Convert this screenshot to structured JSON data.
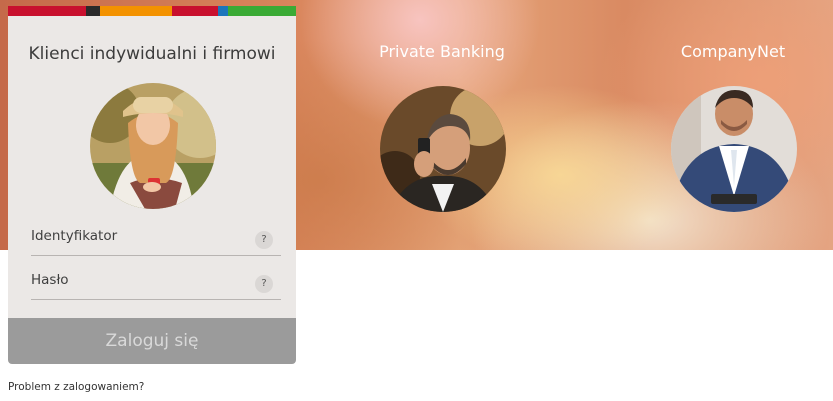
{
  "brand_colors": [
    "#c8102e",
    "#2a2a2a",
    "#f39200",
    "#c8102e",
    "#1b75bb",
    "#3aaa35"
  ],
  "login_panel": {
    "title": "Klienci indywidualni i firmowi",
    "fields": [
      {
        "label": "Identyfikator",
        "help": "?"
      },
      {
        "label": "Hasło",
        "help": "?"
      }
    ],
    "login_button": "Zaloguj się"
  },
  "problem_link": "Problem z zalogowaniem?",
  "sections": [
    {
      "title": "Private Banking"
    },
    {
      "title": "CompanyNet"
    }
  ],
  "icons": [
    "woman-avatar",
    "man-phone-avatar",
    "businessman-avatar",
    "help-icon"
  ]
}
